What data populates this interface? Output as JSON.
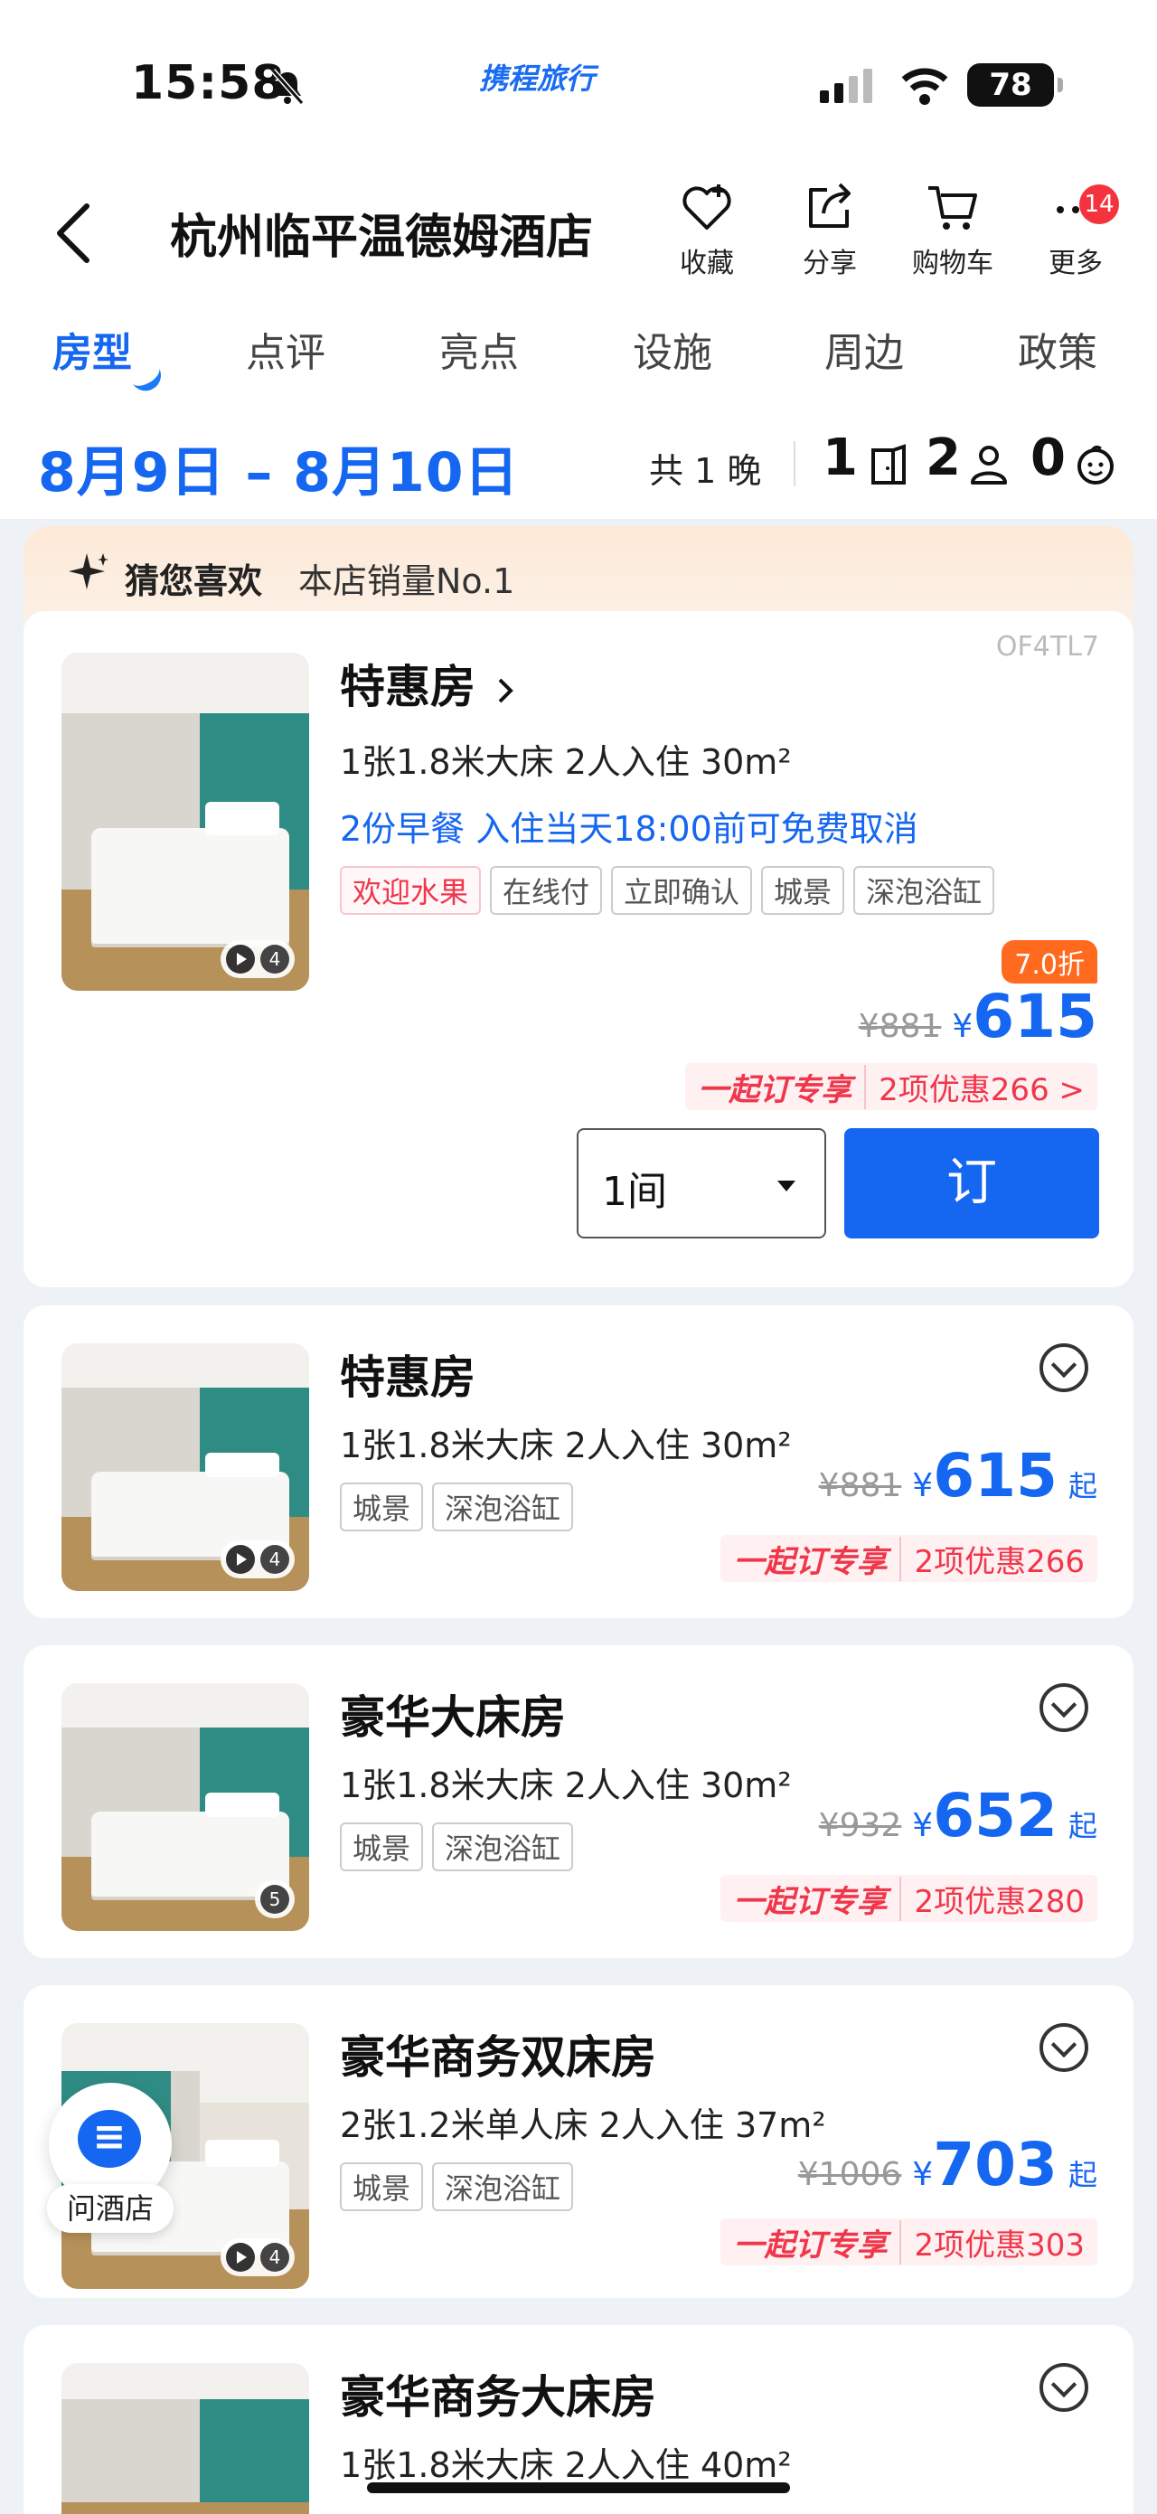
{
  "status": {
    "time": "15:58",
    "brand": "携程旅行",
    "battery": "78"
  },
  "nav": {
    "title": "杭州临平温德姆酒店",
    "actions": [
      {
        "label": "收藏",
        "icon": "heart-plus-icon"
      },
      {
        "label": "分享",
        "icon": "share-icon"
      },
      {
        "label": "购物车",
        "icon": "cart-icon"
      },
      {
        "label": "更多",
        "icon": "more-icon",
        "badge": "14"
      }
    ]
  },
  "tabs": [
    "房型",
    "点评",
    "亮点",
    "设施",
    "周边",
    "政策"
  ],
  "active_tab": "房型",
  "booking": {
    "dates": "8月9日 – 8月10日",
    "nights": "共 1 晚",
    "rooms": "1",
    "adults": "2",
    "children": "0"
  },
  "recommend": {
    "title": "猜您喜欢",
    "subtitle": "本店销量No.1"
  },
  "featured": {
    "code": "OF4TL7",
    "name": "特惠房",
    "spec": "1张1.8米大床  2人入住  30m²",
    "perk": "2份早餐   入住当天18:00前可免费取消",
    "tags": [
      "欢迎水果",
      "在线付",
      "立即确认",
      "城景",
      "深泡浴缸"
    ],
    "media_count": "4",
    "discount": "7.0折",
    "orig_price": "¥881",
    "currency": "¥",
    "price": "615",
    "promo_tag": "一起订专享",
    "promo_text": "2项优惠266 >",
    "qty": "1间",
    "book_label": "订"
  },
  "rooms": [
    {
      "name": "特惠房",
      "spec": "1张1.8米大床  2人入住  30m²",
      "tags": [
        "城景",
        "深泡浴缸"
      ],
      "media_count": "4",
      "orig_price": "¥881",
      "currency": "¥",
      "price": "615",
      "suffix": "起",
      "promo_tag": "一起订专享",
      "promo_text": "2项优惠266"
    },
    {
      "name": "豪华大床房",
      "spec": "1张1.8米大床  2人入住  30m²",
      "tags": [
        "城景",
        "深泡浴缸"
      ],
      "media_count": "5",
      "orig_price": "¥932",
      "currency": "¥",
      "price": "652",
      "suffix": "起",
      "promo_tag": "一起订专享",
      "promo_text": "2项优惠280"
    },
    {
      "name": "豪华商务双床房",
      "spec": "2张1.2米单人床  2人入住  37m²",
      "tags": [
        "城景",
        "深泡浴缸"
      ],
      "media_count": "4",
      "orig_price": "¥1006",
      "currency": "¥",
      "price": "703",
      "suffix": "起",
      "promo_tag": "一起订专享",
      "promo_text": "2项优惠303"
    },
    {
      "name": "豪华商务大床房",
      "spec": "1张1.8米大床  2人入住  40m²"
    }
  ],
  "chat": {
    "label": "问酒店"
  }
}
